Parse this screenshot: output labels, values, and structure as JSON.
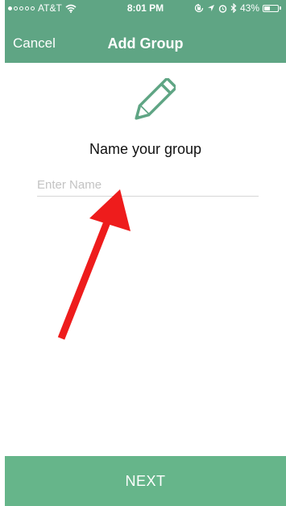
{
  "status_bar": {
    "carrier": "AT&T",
    "time": "8:01 PM",
    "battery_percent": "43%",
    "battery_level": 0.43,
    "signal_bars_filled": 1,
    "signal_bars_total": 5,
    "icons": [
      "wifi-icon",
      "rotation-lock-icon",
      "location-icon",
      "alarm-icon",
      "bluetooth-icon",
      "battery-icon"
    ]
  },
  "nav": {
    "cancel_label": "Cancel",
    "title": "Add Group"
  },
  "main": {
    "icon": "pencil-icon",
    "prompt": "Name your group",
    "name_input": {
      "value": "",
      "placeholder": "Enter Name"
    },
    "annotation": "red-arrow"
  },
  "footer": {
    "next_label": "NEXT"
  },
  "colors": {
    "header": "#5fa584",
    "accent": "#66b58a",
    "arrow": "#ee1c1c"
  }
}
